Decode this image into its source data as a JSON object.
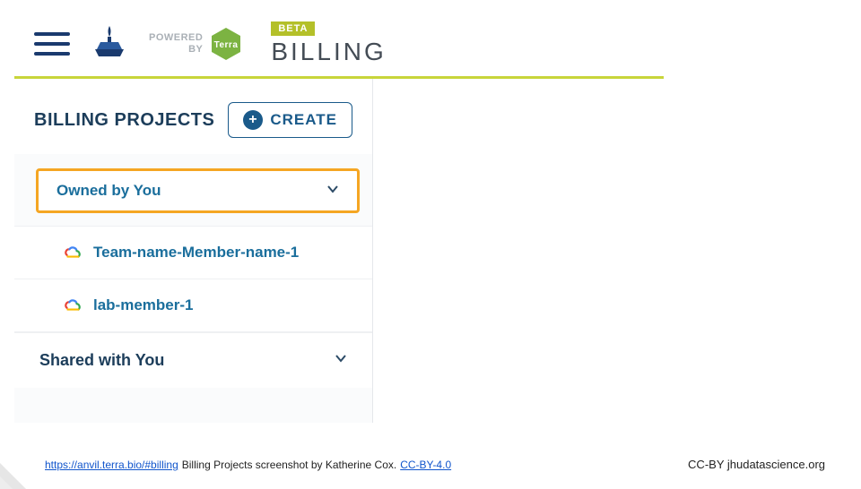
{
  "header": {
    "powered_line1": "POWERED",
    "powered_line2": "BY",
    "terra_label": "Terra",
    "beta": "BETA",
    "title": "BILLING"
  },
  "sidebar": {
    "title": "BILLING PROJECTS",
    "create_label": "CREATE",
    "sections": {
      "owned": {
        "label": "Owned by You"
      },
      "shared": {
        "label": "Shared with You"
      }
    },
    "projects": [
      {
        "name": "Team-name-Member-name-1"
      },
      {
        "name": "lab-member-1"
      }
    ]
  },
  "attribution": {
    "url_text": "https://anvil.terra.bio/#billing",
    "caption": " Billing Projects screenshot by Katherine Cox.  ",
    "license_text": "CC-BY-4.0",
    "ccby_right": "CC-BY  jhudatascience.org"
  }
}
